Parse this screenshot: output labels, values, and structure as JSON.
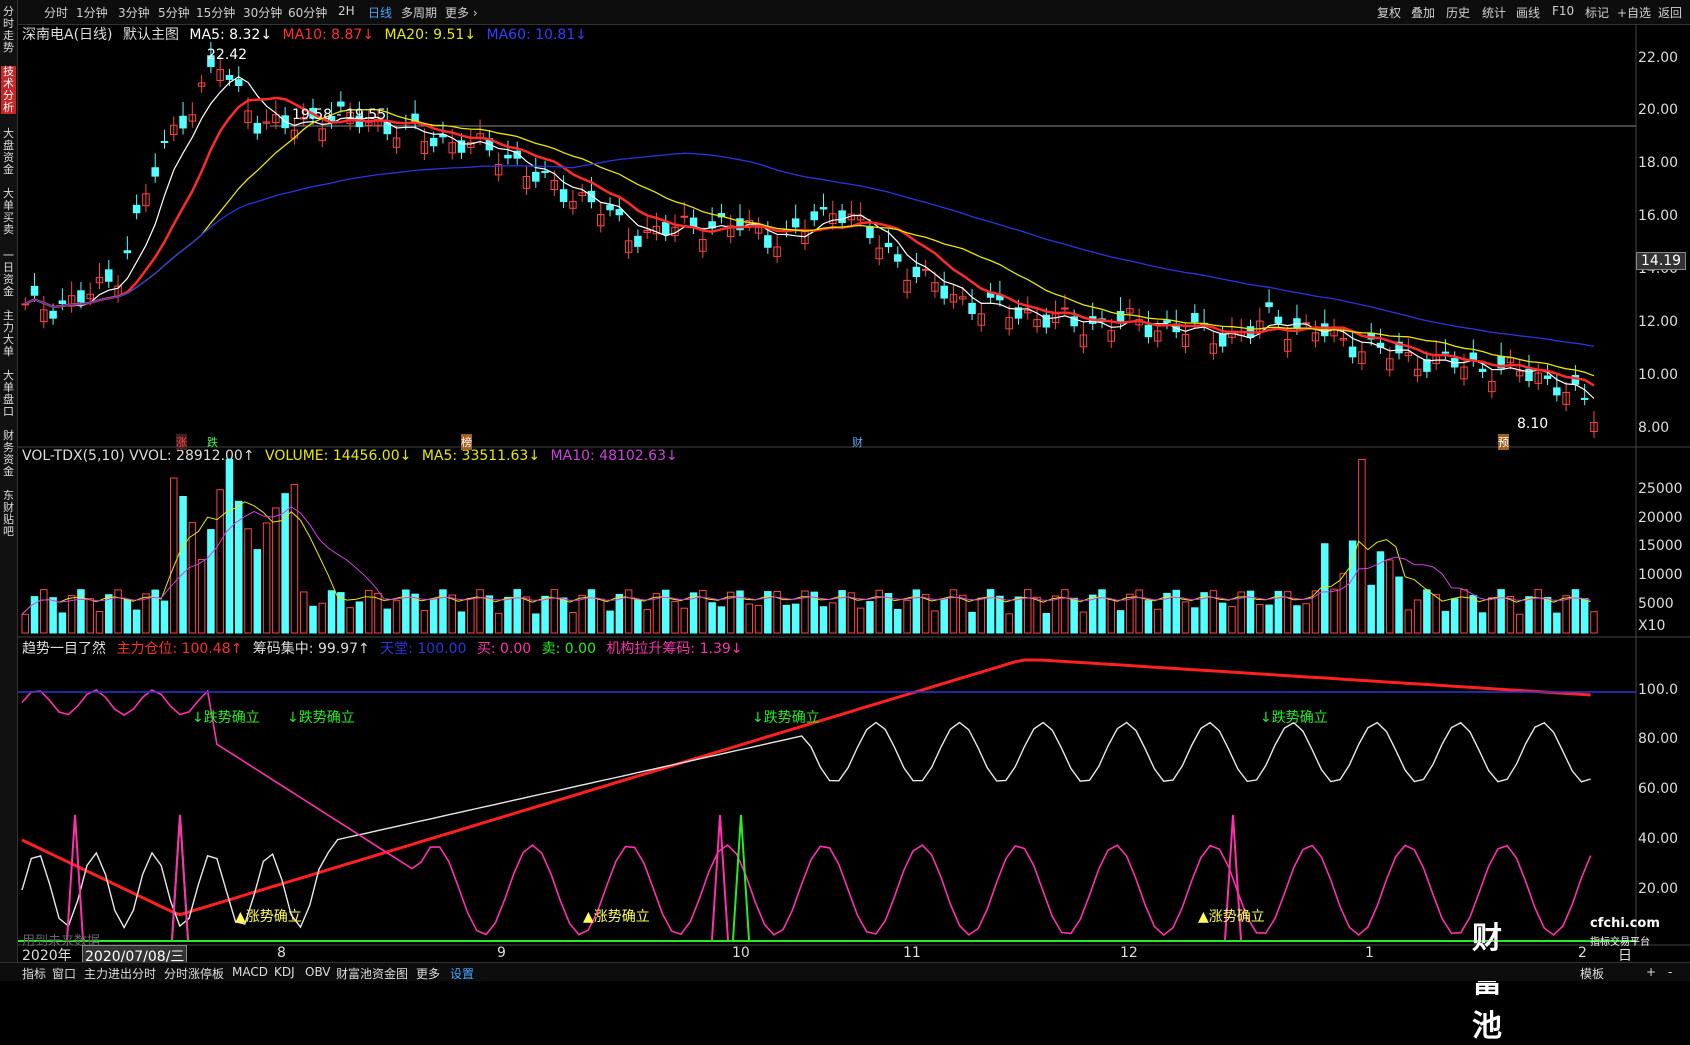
{
  "toolbar": {
    "left": [
      "分时",
      "1分钟",
      "3分钟",
      "5分钟",
      "15分钟",
      "30分钟",
      "60分钟",
      "2H",
      "日线",
      "多周期",
      "更多 ›"
    ],
    "active": "日线",
    "right": [
      "复权",
      "叠加",
      "历史",
      "统计",
      "画线",
      "F10",
      "标记",
      "+自选",
      "返回"
    ]
  },
  "sidebar": [
    "分时走势",
    "技术分析",
    "大盘资金",
    "大单买卖",
    "一日资金",
    "主力大单",
    "大单盘口",
    "财务资金",
    "东财贴吧"
  ],
  "sidebar_active": "技术分析",
  "main": {
    "stock": "深南电A(日线)",
    "chart_selector": "默认主图",
    "ma5": "MA5: 8.32↓",
    "ma10": "MA10: 8.87↓",
    "ma20": "MA20: 9.51↓",
    "ma60": "MA60: 10.81↓",
    "high_label": "22.42",
    "range_label": "19.58 - 19.55",
    "low_label": "8.10",
    "current_price": "14.19",
    "axis": [
      "22.00",
      "20.00",
      "18.00",
      "16.00",
      "14.00",
      "12.00",
      "10.00",
      "8.00"
    ],
    "markers": [
      "涨",
      "跌",
      "榜",
      "财",
      "预"
    ]
  },
  "volume": {
    "title": "VOL-TDX(5,10) VVOL: 28912.00↑",
    "volume": "VOLUME: 14456.00↓",
    "ma5": "MA5: 33511.63↓",
    "ma10": "MA10: 48102.63↓",
    "axis": [
      "25000",
      "20000",
      "15000",
      "10000",
      "5000",
      "X10"
    ]
  },
  "trend": {
    "title": "趋势一目了然",
    "main_pos": "主力仓位: 100.48↑",
    "chip": "筹码集中: 99.97↑",
    "tianting": "天堂: 100.00",
    "buy": "买: 0.00",
    "sell": "卖: 0.00",
    "inst": "机构拉升筹码: 1.39↓",
    "axis": [
      "100.0",
      "80.00",
      "60.00",
      "40.00",
      "20.00"
    ],
    "down_signals": [
      "↓跌势确立",
      "↓跌势确立",
      "↓跌势确立",
      "↓跌势确立"
    ],
    "up_signals": [
      "▲涨势确立",
      "▲涨势确立",
      "▲涨势确立"
    ],
    "watermark": "用到未来数据"
  },
  "timeaxis": {
    "labels": [
      "2020年",
      "2020/07/08/三",
      "8",
      "9",
      "10",
      "11",
      "12",
      "1",
      "2",
      "日线"
    ]
  },
  "bottom": [
    "指标",
    "窗口",
    "主力进出分时",
    "分时涨停板",
    "MACD",
    "KDJ",
    "OBV",
    "财富池资金图",
    "更多",
    "设置"
  ],
  "bottom_active": "设置",
  "bottom_right": [
    "模板",
    "+",
    "-"
  ],
  "brand": {
    "name": "财富池",
    "site": "cfchi.com",
    "tagline": "指标交易平台"
  },
  "colors": {
    "up": "#ff4444",
    "down": "#54ffff",
    "ma5": "#ffffff",
    "ma10": "#ff2b2b",
    "ma20": "#e8e800",
    "ma60": "#2a35e0",
    "pink": "#ff2fae",
    "green": "#22ee22"
  }
}
